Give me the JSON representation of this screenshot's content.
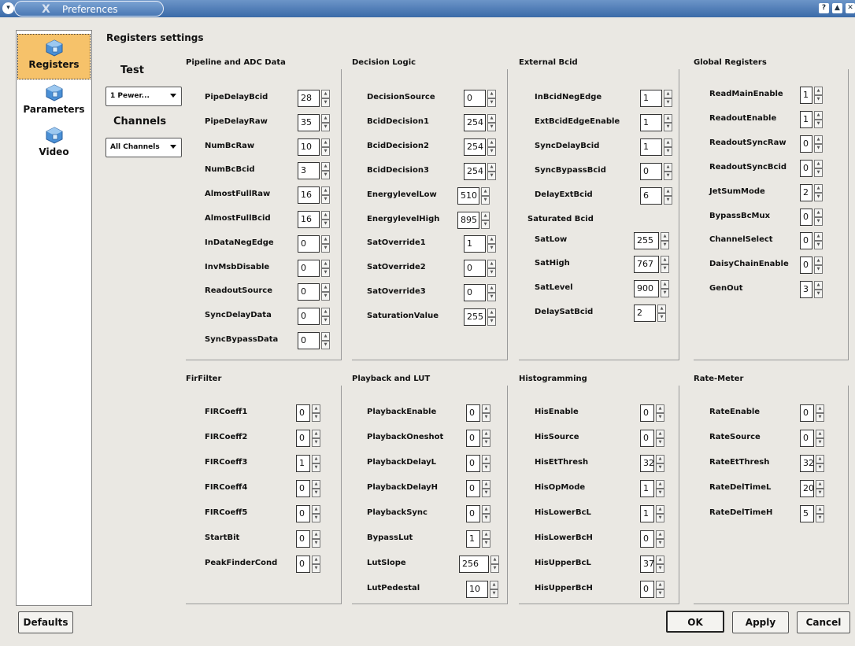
{
  "window": {
    "title": "Preferences",
    "x_icon": "X",
    "menu_icon": "menu-icon",
    "help": "?",
    "shade": "▲",
    "close": "✕"
  },
  "sidebar": {
    "items": [
      {
        "label": "Registers",
        "icon": "registers-icon",
        "active": true
      },
      {
        "label": "Parameters",
        "icon": "parameters-icon",
        "active": false
      },
      {
        "label": "Video",
        "icon": "video-icon",
        "active": false
      }
    ]
  },
  "page_title": "Registers settings",
  "left_controls": {
    "test_label": "Test",
    "test_value": "1 Pewer...",
    "channels_label": "Channels",
    "channels_value": "All Channels"
  },
  "groups": [
    {
      "title": "Pipeline and ADC Data",
      "rows": [
        {
          "label": "PipeDelayBcid",
          "value": "28"
        },
        {
          "label": "PipeDelayRaw",
          "value": "35"
        },
        {
          "label": "NumBcRaw",
          "value": "10"
        },
        {
          "label": "NumBcBcid",
          "value": "3"
        },
        {
          "label": "AlmostFullRaw",
          "value": "16"
        },
        {
          "label": "AlmostFullBcid",
          "value": "16"
        },
        {
          "label": "InDataNegEdge",
          "value": "0"
        },
        {
          "label": "InvMsbDisable",
          "value": "0"
        },
        {
          "label": "ReadoutSource",
          "value": "0"
        },
        {
          "label": "SyncDelayData",
          "value": "0"
        },
        {
          "label": "SyncBypassData",
          "value": "0"
        }
      ]
    },
    {
      "title": "Decision Logic",
      "rows": [
        {
          "label": "DecisionSource",
          "value": "0"
        },
        {
          "label": "BcidDecision1",
          "value": "254"
        },
        {
          "label": "BcidDecision2",
          "value": "254"
        },
        {
          "label": "BcidDecision3",
          "value": "254"
        },
        {
          "label": "EnergylevelLow",
          "value": "510"
        },
        {
          "label": "EnergylevelHigh",
          "value": "895"
        },
        {
          "label": "SatOverride1",
          "value": "1"
        },
        {
          "label": "SatOverride2",
          "value": "0"
        },
        {
          "label": "SatOverride3",
          "value": "0"
        },
        {
          "label": "SaturationValue",
          "value": "255"
        }
      ]
    },
    {
      "title": "External Bcid",
      "subtitle": "Saturated Bcid",
      "rows": [
        {
          "label": "InBcidNegEdge",
          "value": "1"
        },
        {
          "label": "ExtBcidEdgeEnable",
          "value": "1"
        },
        {
          "label": "SyncDelayBcid",
          "value": "1"
        },
        {
          "label": "SyncBypassBcid",
          "value": "0"
        },
        {
          "label": "DelayExtBcid",
          "value": "6"
        },
        {
          "label": "SatLow",
          "value": "255"
        },
        {
          "label": "SatHigh",
          "value": "767"
        },
        {
          "label": "SatLevel",
          "value": "900"
        },
        {
          "label": "DelaySatBcid",
          "value": "2"
        }
      ]
    },
    {
      "title": "Global Registers",
      "rows": [
        {
          "label": "ReadMainEnable",
          "value": "1"
        },
        {
          "label": "ReadoutEnable",
          "value": "1"
        },
        {
          "label": "ReadoutSyncRaw",
          "value": "0"
        },
        {
          "label": "ReadoutSyncBcid",
          "value": "0"
        },
        {
          "label": "JetSumMode",
          "value": "2"
        },
        {
          "label": "BypassBcMux",
          "value": "0"
        },
        {
          "label": "ChannelSelect",
          "value": "0"
        },
        {
          "label": "DaisyChainEnable",
          "value": "0"
        },
        {
          "label": "GenOut",
          "value": "3"
        }
      ]
    },
    {
      "title": "FirFilter",
      "rows": [
        {
          "label": "FIRCoeff1",
          "value": "0"
        },
        {
          "label": "FIRCoeff2",
          "value": "0"
        },
        {
          "label": "FIRCoeff3",
          "value": "1"
        },
        {
          "label": "FIRCoeff4",
          "value": "0"
        },
        {
          "label": "FIRCoeff5",
          "value": "0"
        },
        {
          "label": "StartBit",
          "value": "0"
        },
        {
          "label": "PeakFinderCond",
          "value": "0"
        }
      ]
    },
    {
      "title": "Playback and LUT",
      "rows": [
        {
          "label": "PlaybackEnable",
          "value": "0"
        },
        {
          "label": "PlaybackOneshot",
          "value": "0"
        },
        {
          "label": "PlaybackDelayL",
          "value": "0"
        },
        {
          "label": "PlaybackDelayH",
          "value": "0"
        },
        {
          "label": "PlaybackSync",
          "value": "0"
        },
        {
          "label": "BypassLut",
          "value": "1"
        },
        {
          "label": "LutSlope",
          "value": "256"
        },
        {
          "label": "LutPedestal",
          "value": "10"
        }
      ]
    },
    {
      "title": "Histogramming",
      "rows": [
        {
          "label": "HisEnable",
          "value": "0"
        },
        {
          "label": "HisSource",
          "value": "0"
        },
        {
          "label": "HisEtThresh",
          "value": "32"
        },
        {
          "label": "HisOpMode",
          "value": "1"
        },
        {
          "label": "HisLowerBcL",
          "value": "1"
        },
        {
          "label": "HisLowerBcH",
          "value": "0"
        },
        {
          "label": "HisUpperBcL",
          "value": "37"
        },
        {
          "label": "HisUpperBcH",
          "value": "0"
        }
      ]
    },
    {
      "title": "Rate-Meter",
      "rows": [
        {
          "label": "RateEnable",
          "value": "0"
        },
        {
          "label": "RateSource",
          "value": "0"
        },
        {
          "label": "RateEtThresh",
          "value": "32"
        },
        {
          "label": "RateDelTimeL",
          "value": "20"
        },
        {
          "label": "RateDelTimeH",
          "value": "5"
        }
      ]
    }
  ],
  "buttons": {
    "defaults": "Defaults",
    "ok": "OK",
    "apply": "Apply",
    "cancel": "Cancel"
  }
}
